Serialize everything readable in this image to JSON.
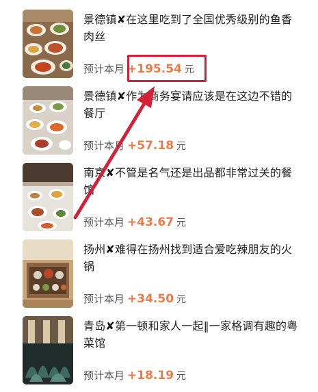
{
  "feed": {
    "estimate_label": "预计本月",
    "currency_unit": "元",
    "items": [
      {
        "city": "景德镇",
        "marker": "✘",
        "title": "在这里吃到了全国优秀级别的鱼香肉丝",
        "amount": "+195.54",
        "thumbnail_icon": "food-photo-icon"
      },
      {
        "city": "景德镇",
        "marker": "✘",
        "title": "作为商务宴请应该是在这边不错的餐厅",
        "amount": "+57.18",
        "thumbnail_icon": "food-photo-icon"
      },
      {
        "city": "南京",
        "marker": "✘",
        "title": "不管是名气还是出品都非常过关的餐馆",
        "amount": "+43.67",
        "thumbnail_icon": "food-photo-icon"
      },
      {
        "city": "扬州",
        "marker": "✘",
        "title": "难得在扬州找到适合爱吃辣朋友的火锅",
        "amount": "+34.50",
        "thumbnail_icon": "hotpot-photo-icon"
      },
      {
        "city": "青岛",
        "marker": "✘",
        "title": "第一顿和家人一起‖一家格调有趣的粤菜馆",
        "amount": "+18.19",
        "thumbnail_icon": "restaurant-interior-photo-icon"
      }
    ]
  },
  "annotation": {
    "highlight_color": "#d2223a",
    "amount_color": "#ef7a45"
  }
}
